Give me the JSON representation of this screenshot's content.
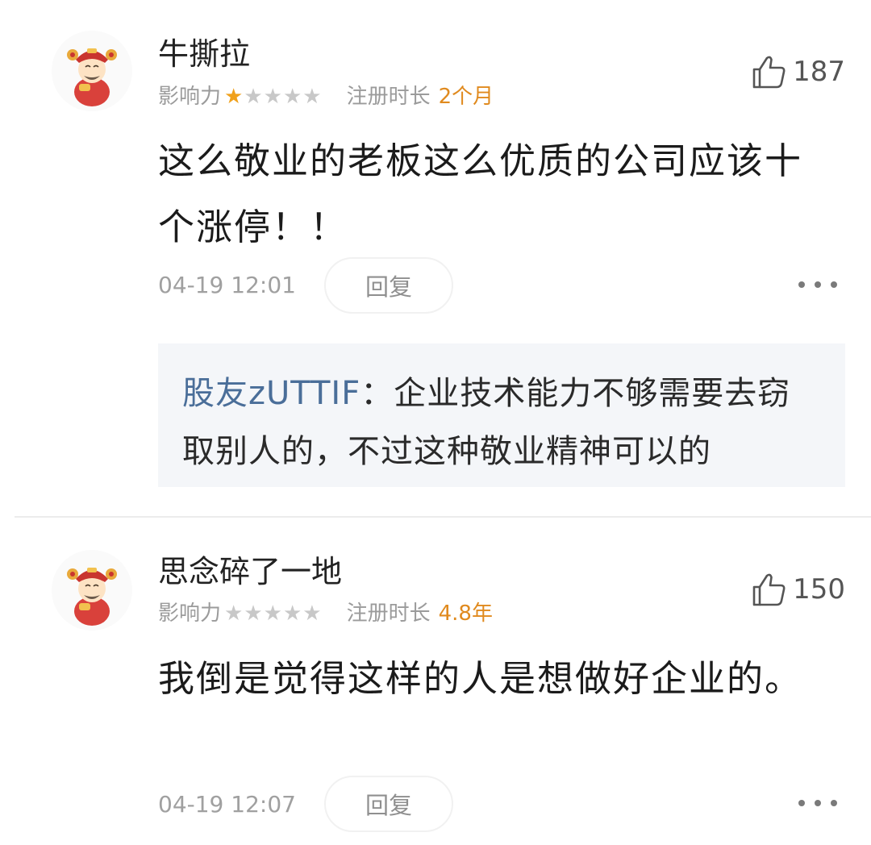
{
  "comments": [
    {
      "username": "牛撕拉",
      "influence_label": "影响力",
      "stars_filled": 1,
      "stars_total": 5,
      "registration_label": "注册时长",
      "registration_value": "2个月",
      "like_count": "187",
      "content": "这么敬业的老板这么优质的公司应该十个涨停！！",
      "timestamp": "04-19 12:01",
      "reply_label": "回复",
      "replies": [
        {
          "username": "股友zUTTIF",
          "separator": "：",
          "text": "企业技术能力不够需要去窃取别人的，不过这种敬业精神可以的"
        }
      ]
    },
    {
      "username": "思念碎了一地",
      "influence_label": "影响力",
      "stars_filled": 0,
      "stars_total": 5,
      "registration_label": "注册时长",
      "registration_value": "4.8年",
      "like_count": "150",
      "content": "我倒是觉得这样的人是想做好企业的。",
      "timestamp": "04-19 12:07",
      "reply_label": "回复",
      "replies": []
    }
  ],
  "icons": {
    "avatar": "god-of-wealth-avatar-icon",
    "like": "thumbs-up-icon",
    "more": "more-dots-icon"
  },
  "colors": {
    "star_active": "#f0a11c",
    "registration_value": "#e08a1e",
    "reply_username": "#4a6e99",
    "reply_background": "#f4f6f9"
  }
}
